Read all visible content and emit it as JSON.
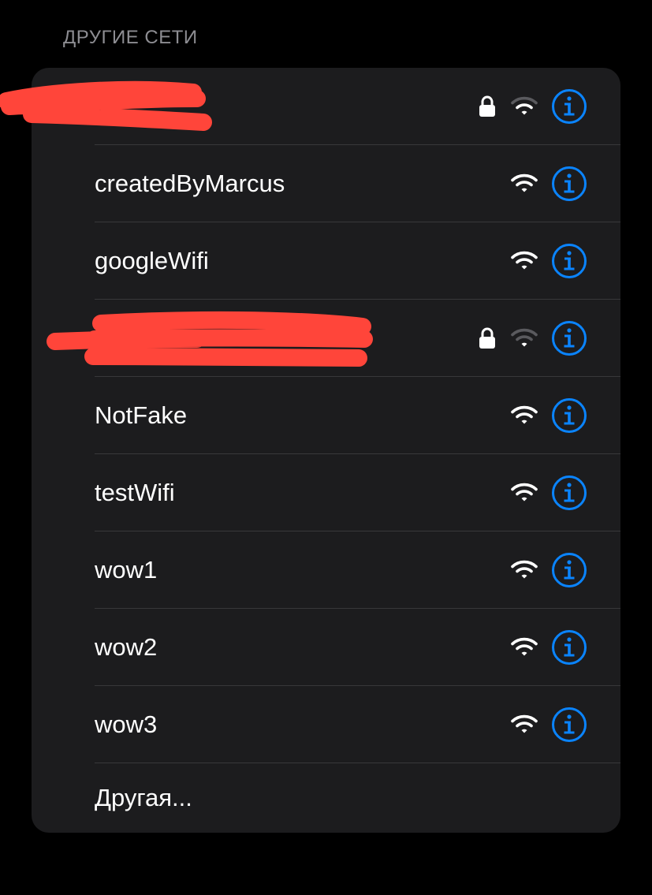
{
  "section": {
    "title": "ДРУГИЕ СЕТИ"
  },
  "networks": [
    {
      "name": "",
      "secured": true,
      "redacted": true
    },
    {
      "name": "createdByMarcus",
      "secured": false
    },
    {
      "name": "googleWifi",
      "secured": false
    },
    {
      "name": "",
      "secured": true,
      "redacted": true
    },
    {
      "name": "NotFake",
      "secured": false
    },
    {
      "name": "testWifi",
      "secured": false
    },
    {
      "name": "wow1",
      "secured": false
    },
    {
      "name": "wow2",
      "secured": false
    },
    {
      "name": "wow3",
      "secured": false
    }
  ],
  "other_option": {
    "label": "Другая..."
  },
  "icons": {
    "lock": "lock-icon",
    "wifi": "wifi-icon",
    "info": "info-icon"
  },
  "colors": {
    "background": "#000000",
    "card": "#1c1c1e",
    "accent": "#0a84ff",
    "text": "#ffffff",
    "secondary_text": "#8d8d92",
    "separator": "#38383a",
    "redaction": "#ff453a"
  }
}
